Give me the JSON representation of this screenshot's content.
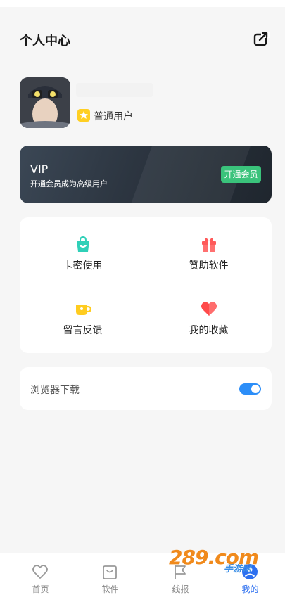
{
  "header": {
    "title": "个人中心",
    "share_icon": "share-icon"
  },
  "profile": {
    "level_text": "普通用户"
  },
  "vip": {
    "title": "VIP",
    "subtitle": "开通会员成为高级用户",
    "button": "开通会员"
  },
  "menu": {
    "items": [
      {
        "label": "卡密使用",
        "icon": "bag-icon",
        "color": "#2fd0b8"
      },
      {
        "label": "赞助软件",
        "icon": "gift-icon",
        "color": "#ff5a5a"
      },
      {
        "label": "留言反馈",
        "icon": "cup-icon",
        "color": "#ffcc1f"
      },
      {
        "label": "我的收藏",
        "icon": "heart-icon",
        "color": "#ff4a4a"
      }
    ]
  },
  "settings": {
    "browser_download_label": "浏览器下载",
    "browser_download_enabled": true
  },
  "tabbar": {
    "tabs": [
      {
        "label": "首页",
        "icon": "heart-outline-icon"
      },
      {
        "label": "软件",
        "icon": "bag-outline-icon"
      },
      {
        "label": "线报",
        "icon": "flag-outline-icon"
      },
      {
        "label": "我的",
        "icon": "user-icon",
        "active": true
      }
    ]
  },
  "watermark": {
    "text": "289.com",
    "sub": "手游网"
  },
  "colors": {
    "accent": "#2c6ff0",
    "vip_button": "#3ac37b",
    "toggle_on": "#2c8ef8"
  }
}
